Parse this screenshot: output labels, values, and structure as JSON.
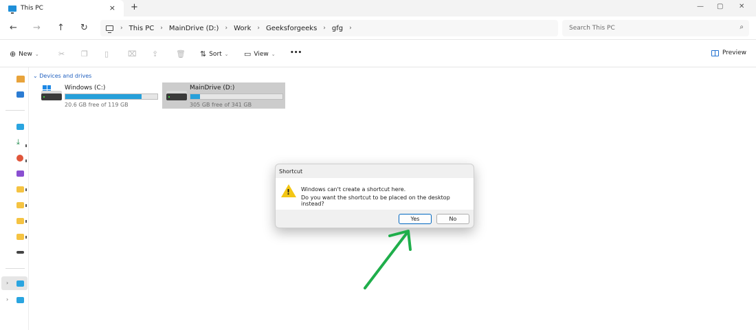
{
  "window": {
    "tab_title": "This PC",
    "tab_close": "×",
    "new_tab": "+",
    "minimize": "—",
    "maximize": "▢",
    "close": "✕"
  },
  "nav": {
    "back": "←",
    "forward": "→",
    "up": "↑",
    "refresh": "↻"
  },
  "address": {
    "breadcrumbs": [
      "This PC",
      "MainDrive (D:)",
      "Work",
      "Geeksforgeeks",
      "gfg"
    ],
    "separator": "›"
  },
  "search": {
    "placeholder": "Search This PC"
  },
  "toolbar": {
    "new_label": "New",
    "sort_label": "Sort",
    "view_label": "View",
    "more_label": "•••",
    "preview_label": "Preview"
  },
  "content": {
    "group_header": "Devices and drives",
    "drives": [
      {
        "name": "Windows (C:)",
        "free_text": "20.6 GB free of 119 GB",
        "used_fraction": 0.827
      },
      {
        "name": "MainDrive (D:)",
        "free_text": "305 GB free of 341 GB",
        "used_fraction": 0.106
      }
    ]
  },
  "dialog": {
    "title": "Shortcut",
    "line1": "Windows can't create a shortcut here.",
    "line2": "Do you want the shortcut to be placed on the desktop instead?",
    "yes_label": "Yes",
    "no_label": "No"
  },
  "colors": {
    "accent": "#0067c0",
    "bar_fill": "#26a0da",
    "annotation_arrow": "#1fae4b",
    "warning": "#f3c614"
  }
}
